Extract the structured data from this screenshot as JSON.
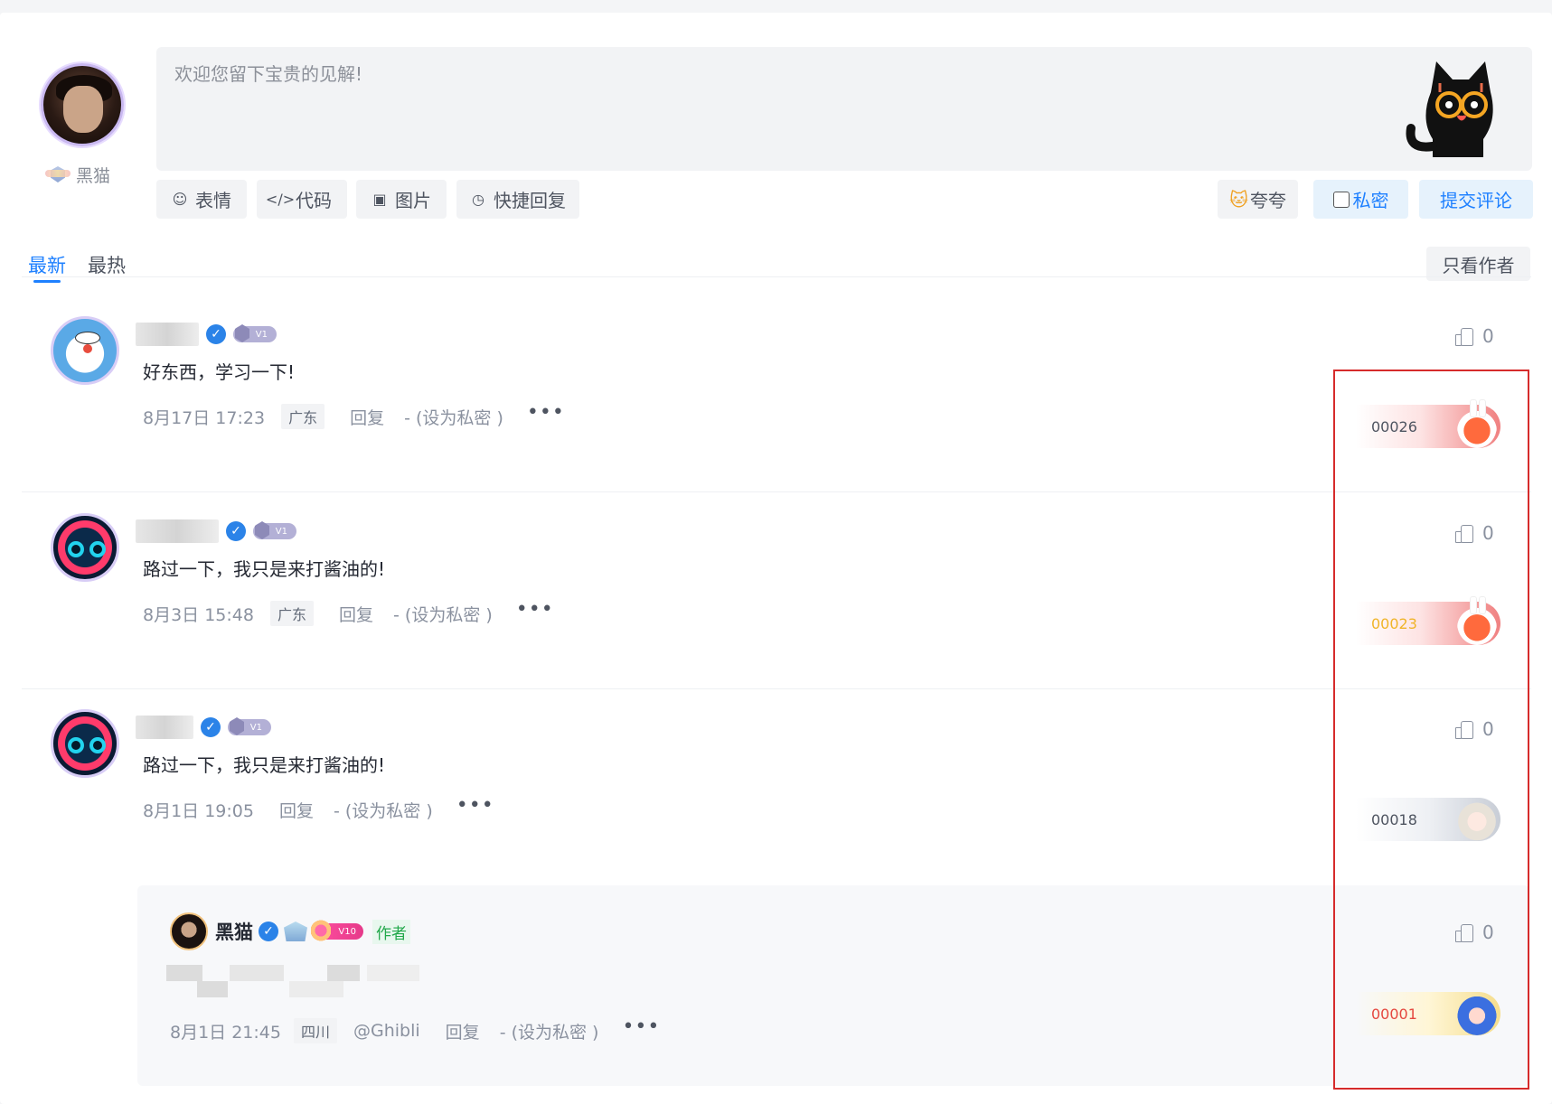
{
  "composer": {
    "user_name": "黑猫",
    "placeholder": "欢迎您留下宝贵的见解!",
    "tools": [
      {
        "icon": "smile-icon",
        "label": "表情"
      },
      {
        "icon": "code-icon",
        "label": "代码"
      },
      {
        "icon": "image-icon",
        "label": "图片"
      },
      {
        "icon": "quick-reply-icon",
        "label": "快捷回复"
      }
    ],
    "kuakua_label": "夸夸",
    "private_label": "私密",
    "submit_label": "提交评论"
  },
  "tabs": {
    "latest": "最新",
    "hot": "最热",
    "only_author": "只看作者"
  },
  "comments": [
    {
      "level": "V1",
      "text": "好东西，学习一下!",
      "time": "8月17日 17:23",
      "location": "广东",
      "reply": "回复",
      "set_private": "- (设为私密  )",
      "likes": "0",
      "floor": "00026",
      "floor_color": "#4e5460"
    },
    {
      "level": "V1",
      "text": "路过一下，我只是来打酱油的!",
      "time": "8月3日 15:48",
      "location": "广东",
      "reply": "回复",
      "set_private": "- (设为私密  )",
      "likes": "0",
      "floor": "00023",
      "floor_color": "#f0b429"
    },
    {
      "level": "V1",
      "text": "路过一下，我只是来打酱油的!",
      "time": "8月1日 19:05",
      "location": "",
      "reply": "回复",
      "set_private": "- (设为私密  )",
      "likes": "0",
      "floor": "00018",
      "floor_color": "#4e5460"
    }
  ],
  "reply": {
    "user_name": "黑猫",
    "level": "V10",
    "author_tag": "作者",
    "time": "8月1日 21:45",
    "location": "四川",
    "mention": "@Ghibli",
    "reply": "回复",
    "set_private": "- (设为私密  )",
    "likes": "0",
    "floor": "00001",
    "floor_color": "#e5483f"
  },
  "colors": {
    "accent": "#1e80ff",
    "highlight_border": "#d62b2b"
  }
}
